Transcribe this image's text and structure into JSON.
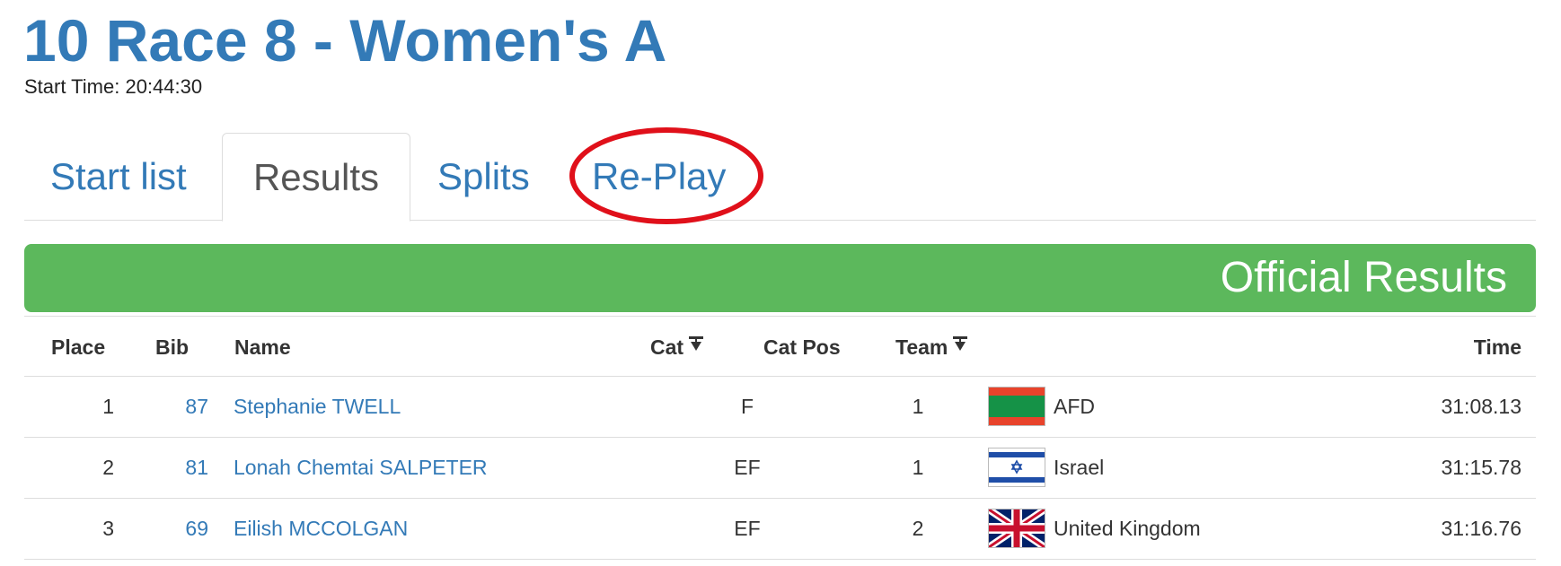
{
  "race": {
    "title": "10 Race 8 - Women's A",
    "start_time": "Start Time: 20:44:30"
  },
  "tabs": [
    {
      "label": "Start list",
      "active": false
    },
    {
      "label": "Results",
      "active": true
    },
    {
      "label": "Splits",
      "active": false
    },
    {
      "label": "Re-Play",
      "active": false,
      "highlighted": true
    }
  ],
  "banner": {
    "text": "Official Results",
    "color": "#5cb85c"
  },
  "table": {
    "headers": {
      "place": "Place",
      "bib": "Bib",
      "name": "Name",
      "cat": "Cat",
      "cat_pos": "Cat Pos",
      "team": "Team",
      "time": "Time"
    },
    "rows": [
      {
        "place": "1",
        "bib": "87",
        "name": "Stephanie TWELL",
        "cat": "F",
        "cat_pos": "1",
        "team": "AFD",
        "flag": "afd-flag",
        "time": "31:08.13"
      },
      {
        "place": "2",
        "bib": "81",
        "name": "Lonah Chemtai SALPETER",
        "cat": "EF",
        "cat_pos": "1",
        "team": "Israel",
        "flag": "israel-flag",
        "time": "31:15.78"
      },
      {
        "place": "3",
        "bib": "69",
        "name": "Eilish MCCOLGAN",
        "cat": "EF",
        "cat_pos": "2",
        "team": "United Kingdom",
        "flag": "uk-flag",
        "time": "31:16.76"
      }
    ]
  },
  "colors": {
    "link": "#337ab7",
    "highlight_circle": "#e0101a"
  }
}
